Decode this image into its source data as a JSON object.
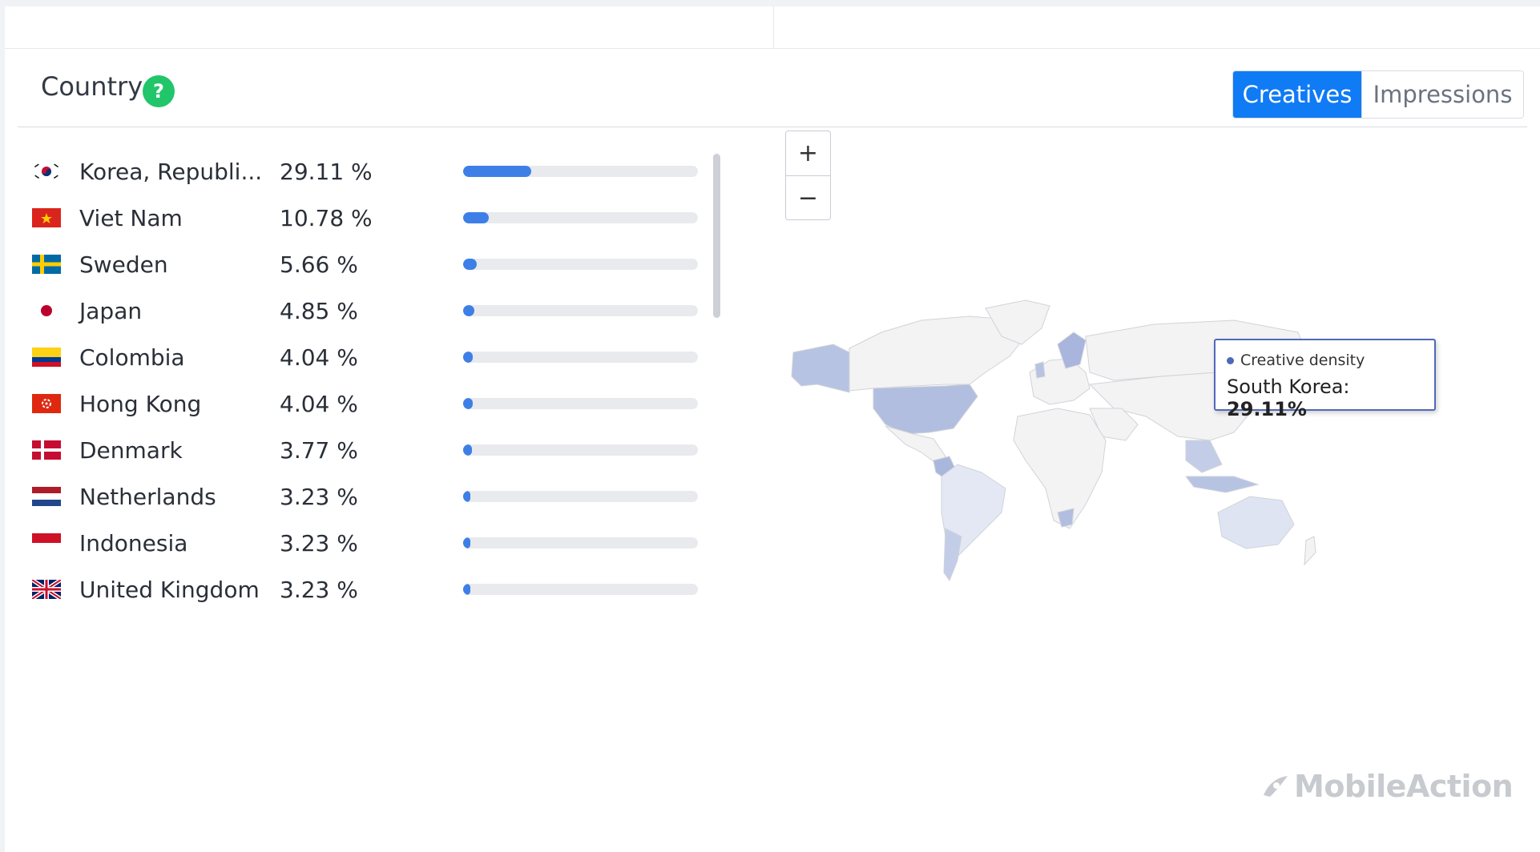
{
  "panel": {
    "title": "Country",
    "help_icon": "?"
  },
  "toggle": {
    "creatives_label": "Creatives",
    "impressions_label": "Impressions",
    "active": "Creatives"
  },
  "countries": [
    {
      "name": "Korea, Republi...",
      "percent": "29.11 %",
      "value": 29.11,
      "flag": "kr"
    },
    {
      "name": "Viet Nam",
      "percent": "10.78 %",
      "value": 10.78,
      "flag": "vn"
    },
    {
      "name": "Sweden",
      "percent": "5.66 %",
      "value": 5.66,
      "flag": "se"
    },
    {
      "name": "Japan",
      "percent": "4.85 %",
      "value": 4.85,
      "flag": "jp"
    },
    {
      "name": "Colombia",
      "percent": "4.04 %",
      "value": 4.04,
      "flag": "co"
    },
    {
      "name": "Hong Kong",
      "percent": "4.04 %",
      "value": 4.04,
      "flag": "hk"
    },
    {
      "name": "Denmark",
      "percent": "3.77 %",
      "value": 3.77,
      "flag": "dk"
    },
    {
      "name": "Netherlands",
      "percent": "3.23 %",
      "value": 3.23,
      "flag": "nl"
    },
    {
      "name": "Indonesia",
      "percent": "3.23 %",
      "value": 3.23,
      "flag": "id"
    },
    {
      "name": "United Kingdom",
      "percent": "3.23 %",
      "value": 3.23,
      "flag": "gb"
    }
  ],
  "map": {
    "zoom_in": "+",
    "zoom_out": "−"
  },
  "tooltip": {
    "series": "Creative density",
    "country": "South Korea: ",
    "value": "29.11%"
  },
  "branding": {
    "logo_text": "MobileAction"
  },
  "colors": {
    "accent": "#0f7bf5",
    "bar_fill": "#3d7fe6",
    "help_green": "#21c56a"
  }
}
